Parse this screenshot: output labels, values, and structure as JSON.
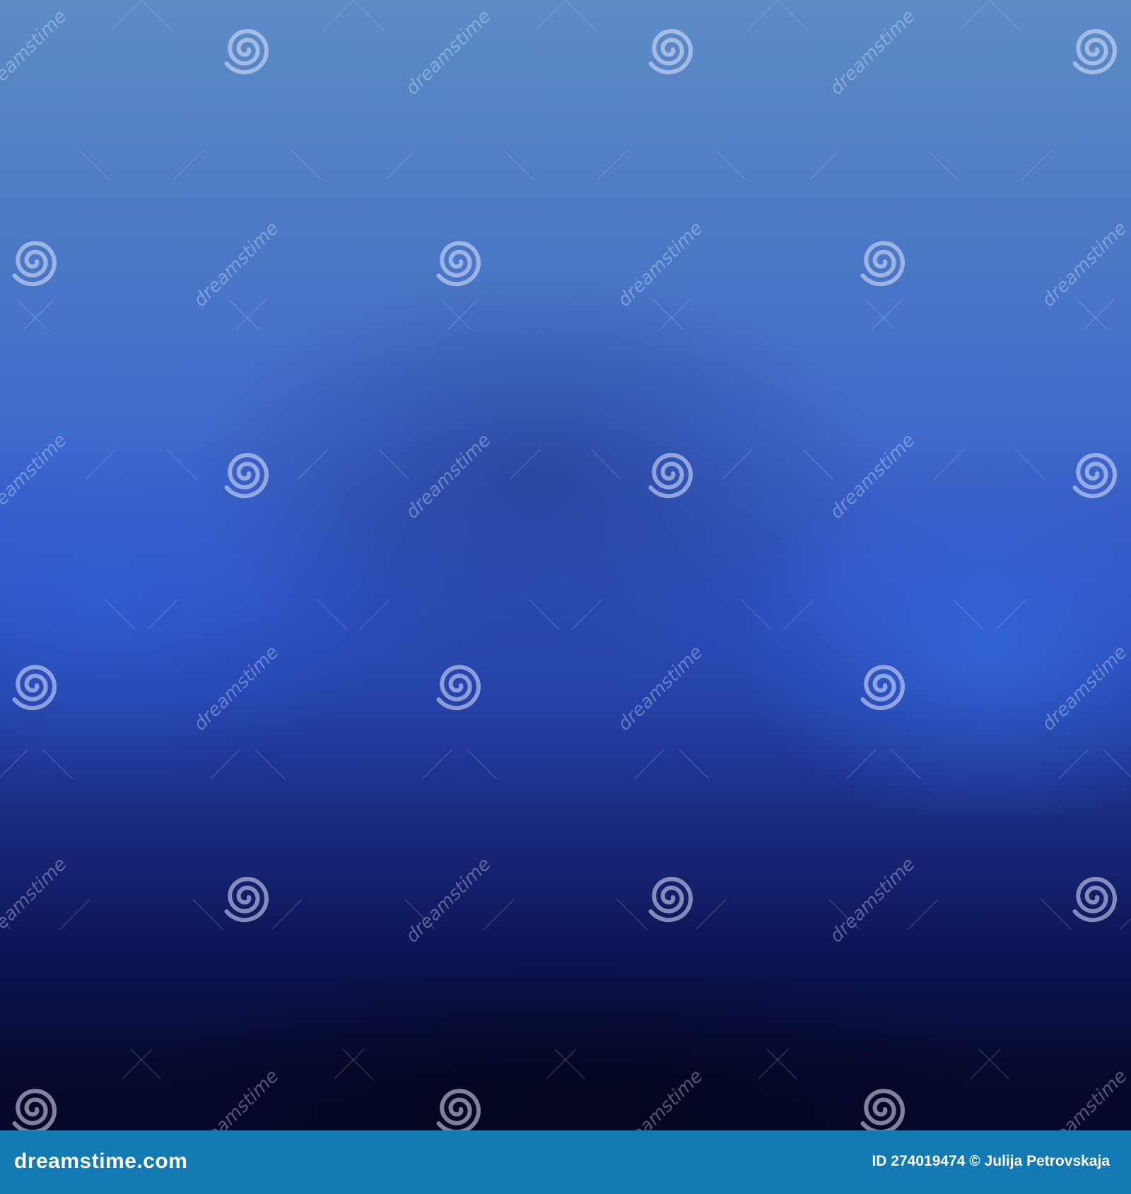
{
  "image": {
    "description_colors": {
      "top": "#5d8cc6",
      "middle": "#2f52c0",
      "bottom": "#05082a"
    }
  },
  "watermark": {
    "text": "dreamstime",
    "icon": "spiral-icon"
  },
  "footer": {
    "background_color": "#137ab3",
    "logo_text": "dreamstime.com",
    "credit_text": "ID 274019474 © Julija Petrovskaja"
  }
}
